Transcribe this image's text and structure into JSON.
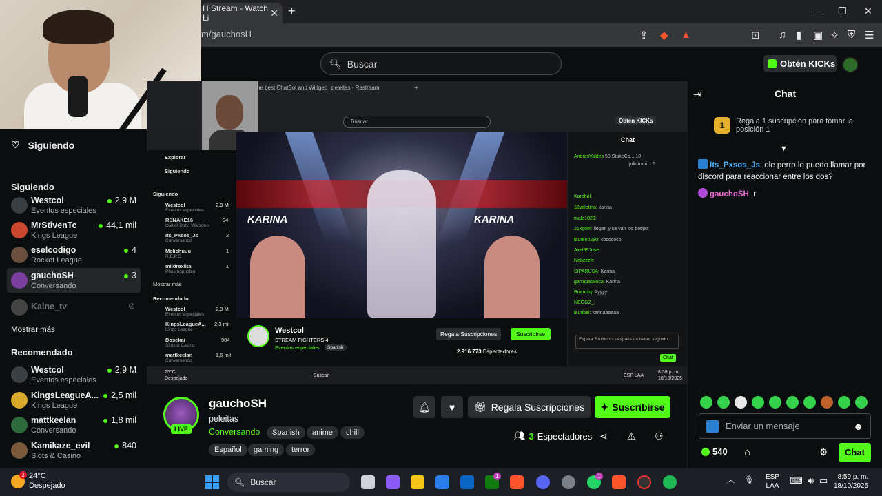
{
  "browser": {
    "tab_title": "H Stream - Watch Li",
    "tab_close": "✕",
    "new_tab": "+",
    "url": "m/gauchosH",
    "window_controls": [
      "—",
      "❐",
      "✕"
    ]
  },
  "header": {
    "search_placeholder": "Buscar",
    "kicks_label": "Obtén KICKs"
  },
  "sidebar": {
    "following_top": "Siguiendo",
    "following_header": "Siguiendo",
    "following": [
      {
        "name": "Westcol",
        "category": "Eventos especiales",
        "viewers": "2,9 M",
        "color": "#3a3f44"
      },
      {
        "name": "MrStivenTc",
        "category": "Kings League",
        "viewers": "44,1 mil",
        "color": "#c9472f"
      },
      {
        "name": "eselcodigo",
        "category": "Rocket League",
        "viewers": "4",
        "color": "#6b4f3f"
      },
      {
        "name": "gauchoSH",
        "category": "Conversando",
        "viewers": "3",
        "color": "#7b3fa0"
      },
      {
        "name": "Kaine_tv",
        "category": "",
        "viewers": "",
        "color": "#444"
      }
    ],
    "show_more_1": "Mostrar más",
    "recommended_header": "Recomendado",
    "recommended": [
      {
        "name": "Westcol",
        "category": "Eventos especiales",
        "viewers": "2,9 M",
        "color": "#3a3f44"
      },
      {
        "name": "KingsLeagueA...",
        "category": "Kings League",
        "viewers": "2,5 mil",
        "color": "#d8a92b"
      },
      {
        "name": "mattkeelan",
        "category": "Conversando",
        "viewers": "1,8 mil",
        "color": "#2d6a3c"
      },
      {
        "name": "Kamikaze_evil",
        "category": "Slots & Casino",
        "viewers": "840",
        "color": "#7a5a3a"
      }
    ]
  },
  "video": {
    "inner_tabs": [
      "he best ChatBot and Widget:",
      "peleitas - Restream",
      "+"
    ],
    "inner_search": "Buscar",
    "inner_kicks": "Obtén KICKs",
    "banner_left": "KARINA",
    "banner_right": "KARINA",
    "inner_chat_title": "Chat",
    "inner_chat": [
      {
        "user": "AndresValdes",
        "text": "50   StakeCo... 10"
      },
      {
        "user": "",
        "text": "juliorodri... 5"
      },
      {
        "user": "Karehol:",
        "text": ""
      },
      {
        "user": "12valetina:",
        "text": "karina"
      },
      {
        "user": "male1029:",
        "text": ""
      },
      {
        "user": "21xgom:",
        "text": "llegan y se van los botijas"
      },
      {
        "user": "lauren0280:",
        "text": "cocococo"
      },
      {
        "user": "Axel95Jose",
        "text": ""
      },
      {
        "user": "Nebzzzfr:",
        "text": ""
      },
      {
        "user": "SIPARUSA:",
        "text": "Karina"
      },
      {
        "user": "garrapataloca:",
        "text": "Karina"
      },
      {
        "user": "Brianrxq:",
        "text": "Ayyyy"
      },
      {
        "user": "NEGGZ_:",
        "text": ""
      },
      {
        "user": "lauribel:",
        "text": "karinaaaaaa"
      }
    ],
    "inner_chat_input": "Espera 5 minutos después de haber seguido",
    "inner_chat_button": "Chat",
    "inner_left": [
      {
        "name": "Explorar",
        "cat": ""
      },
      {
        "name": "Siguiendo",
        "cat": ""
      },
      {
        "name": "Siguiendo",
        "cat": ""
      },
      {
        "name": "Westcol",
        "cat": "Eventos especiales",
        "cnt": "2,9 M"
      },
      {
        "name": "RSNAKE16",
        "cat": "Call of Duty: Warzone",
        "cnt": "94"
      },
      {
        "name": "Its_Pxsos_Js",
        "cat": "Conversando",
        "cnt": "2"
      },
      {
        "name": "Melichuuu",
        "cat": "R.E.P.O.",
        "cnt": "1"
      },
      {
        "name": "mildrexlita",
        "cat": "Phasmophobia",
        "cnt": "1"
      },
      {
        "name": "Mostrar más",
        "cat": ""
      },
      {
        "name": "Recomendado",
        "cat": ""
      },
      {
        "name": "Westcol",
        "cat": "Eventos especiales",
        "cnt": "2,9 M"
      },
      {
        "name": "KingsLeagueA...",
        "cat": "Kings League",
        "cnt": "2,3 mil"
      },
      {
        "name": "Dosekai",
        "cat": "Slots & Casino",
        "cnt": "904"
      },
      {
        "name": "mattkeelan",
        "cat": "Conversando",
        "cnt": "1,6 mil"
      }
    ],
    "inner_streamer": "Westcol",
    "inner_stream_title": "STREAM FIGHTERS 4",
    "inner_category": "Eventos especiales",
    "inner_tag": "Spanish",
    "inner_gift": "Regala Suscripciones",
    "inner_subscribe": "Suscribirse",
    "inner_viewers": "2.916.773",
    "inner_viewers_label": "Espectadores",
    "inner_weather": "25°C",
    "inner_weather_desc": "Despejado",
    "inner_taskbar_search": "Buscar",
    "inner_lang": "ESP LAA",
    "inner_time": "8:59 p. m.",
    "inner_date": "18/10/2025"
  },
  "chat": {
    "title": "Chat",
    "promo": "Regala 1 suscripción para tomar la posición 1",
    "promo_badge": "1",
    "messages": [
      {
        "user": "Its_Pxsos_Js",
        "text": ": ole perro lo puedo llamar por discord para reaccionar entre los dos?",
        "color": "#4fb3ff",
        "badge": "#2a80d0"
      },
      {
        "user": "gauchoSH",
        "text": ": r",
        "color": "#e36bd0",
        "badge": "#b04ad6"
      }
    ],
    "input_placeholder": "Enviar un mensaje",
    "points": "540",
    "send_label": "Chat"
  },
  "stream": {
    "name": "gauchoSH",
    "title": "peleitas",
    "category": "Conversando",
    "tags": [
      "Spanish",
      "anime",
      "chill",
      "Español",
      "gaming",
      "terror"
    ],
    "live": "LIVE",
    "gift_label": "Regala Suscripciones",
    "subscribe_label": "Suscribirse",
    "viewer_count": "3",
    "viewer_label": "Espectadores"
  },
  "taskbar": {
    "weather_temp": "24°C",
    "weather_desc": "Despejado",
    "weather_badge": "3",
    "search": "Buscar",
    "lang_1": "ESP",
    "lang_2": "LAA",
    "time": "8:59 p. m.",
    "date": "18/10/2025",
    "notif_edge": "1",
    "notif_whatsapp": "1"
  }
}
